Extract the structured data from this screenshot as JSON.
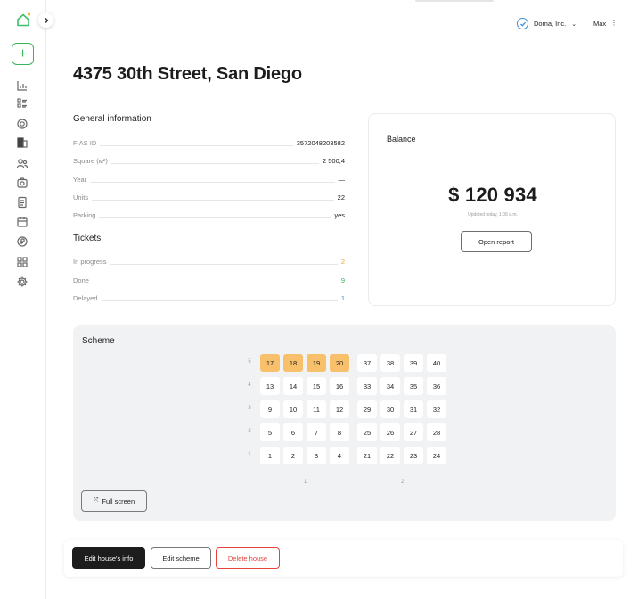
{
  "sidebar": {
    "logo_icon": "house-logo-icon",
    "collapse_icon": "chevron-right-icon",
    "add_label": "+",
    "nav_icons": [
      "chart-icon",
      "list-icon",
      "target-icon",
      "building-icon",
      "users-icon",
      "camera-icon",
      "document-icon",
      "calendar-icon",
      "currency-icon",
      "grid-icon",
      "gear-icon"
    ]
  },
  "topbar": {
    "org_name": "Doma, Inc.",
    "org_chevron": "⌄",
    "user_name": "Max",
    "user_more": "⋮"
  },
  "page": {
    "title": "4375 30th Street, San Diego"
  },
  "general_info": {
    "title": "General information",
    "rows": [
      {
        "label": "FIAS ID",
        "value": "3572048203582"
      },
      {
        "label": "Square (м²)",
        "value": "2 500,4"
      },
      {
        "label": "Year",
        "value": "—"
      },
      {
        "label": "Units",
        "value": "22"
      },
      {
        "label": "Parking",
        "value": "yes"
      }
    ]
  },
  "tickets": {
    "title": "Tickets",
    "rows": [
      {
        "label": "In progress",
        "value": "2",
        "color": "#f0a23a"
      },
      {
        "label": "Done",
        "value": "9",
        "color": "#2fb36a"
      },
      {
        "label": "Delayed",
        "value": "1",
        "color": "#3b8fd8"
      }
    ]
  },
  "balance": {
    "title": "Balance",
    "amount": "$ 120 934",
    "updated": "Updated today, 1:09 a.m.",
    "report_label": "Open report"
  },
  "scheme": {
    "title": "Scheme",
    "floors": [
      "5",
      "4",
      "3",
      "2",
      "1"
    ],
    "entrances": [
      "1",
      "2"
    ],
    "entrance_units": [
      [
        [
          "17",
          "18",
          "19",
          "20"
        ],
        [
          "13",
          "14",
          "15",
          "16"
        ],
        [
          "9",
          "10",
          "11",
          "12"
        ],
        [
          "5",
          "6",
          "7",
          "8"
        ],
        [
          "1",
          "2",
          "3",
          "4"
        ]
      ],
      [
        [
          "37",
          "38",
          "39",
          "40"
        ],
        [
          "33",
          "34",
          "35",
          "36"
        ],
        [
          "29",
          "30",
          "31",
          "32"
        ],
        [
          "25",
          "26",
          "27",
          "28"
        ],
        [
          "21",
          "22",
          "23",
          "24"
        ]
      ]
    ],
    "highlighted_units": [
      "17",
      "18",
      "19",
      "20"
    ],
    "highlight_color": "#f8c06a",
    "fullscreen_label": "Full screen",
    "fullscreen_icon": "expand-icon"
  },
  "actions": {
    "edit_info": "Edit house's info",
    "edit_scheme": "Edit scheme",
    "delete": "Delete house"
  }
}
